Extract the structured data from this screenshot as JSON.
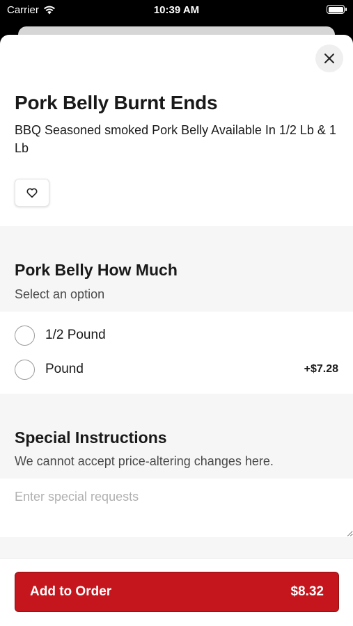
{
  "status_bar": {
    "carrier": "Carrier",
    "time": "10:39 AM"
  },
  "item": {
    "title": "Pork Belly Burnt Ends",
    "description": "BBQ Seasoned smoked Pork Belly Available In 1/2 Lb & 1 Lb"
  },
  "option_group": {
    "title": "Pork Belly How Much",
    "subtitle": "Select an option",
    "options": [
      {
        "label": "1/2 Pound",
        "price": ""
      },
      {
        "label": "Pound",
        "price": "+$7.28"
      }
    ]
  },
  "special_instructions": {
    "title": "Special Instructions",
    "subtitle": "We cannot accept price-altering changes here.",
    "placeholder": "Enter special requests",
    "value": ""
  },
  "footer": {
    "add_label": "Add to Order",
    "total": "$8.32"
  },
  "colors": {
    "accent": "#c4161c",
    "section_bg": "#f6f6f6"
  },
  "icons": {
    "close": "close-icon",
    "favorite": "heart-icon",
    "wifi": "wifi-icon",
    "battery": "battery-icon"
  }
}
